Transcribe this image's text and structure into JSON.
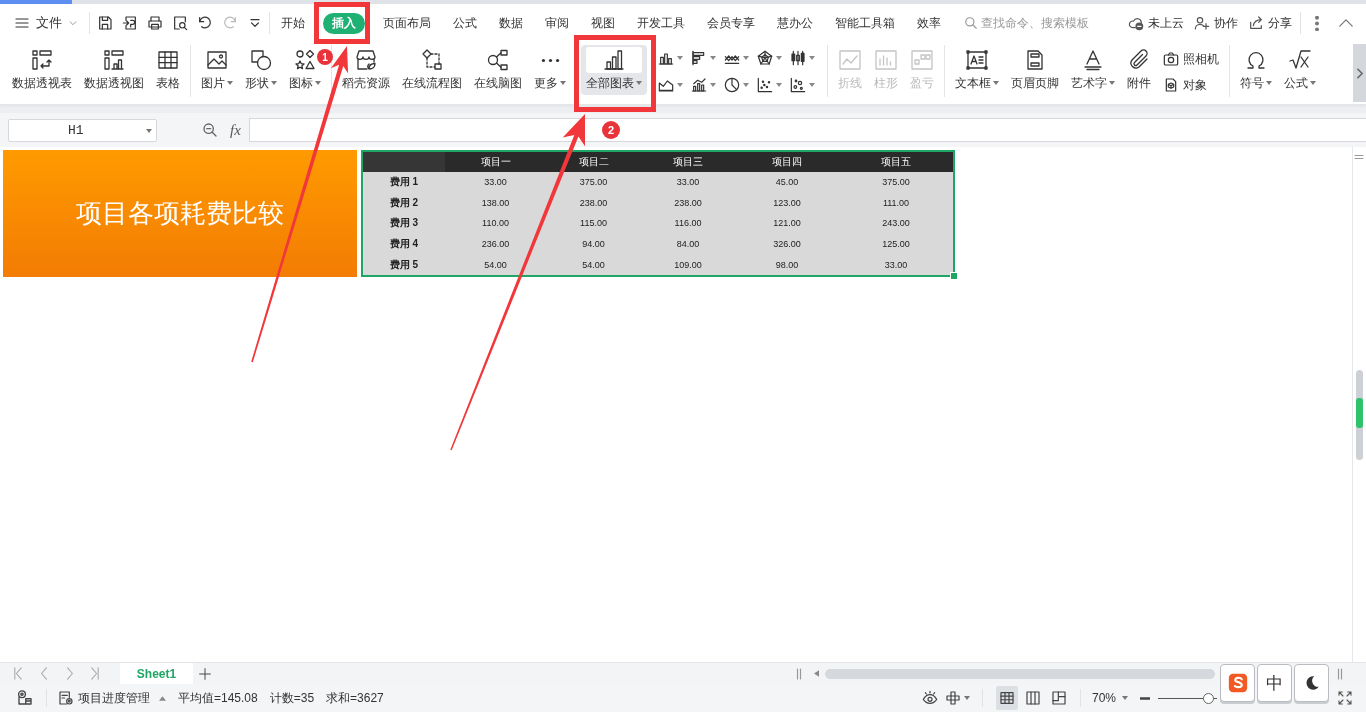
{
  "menu_bar": {
    "file_menu": {
      "label": "文件"
    },
    "quick_access": [
      {
        "kind": "save",
        "disabled": false
      },
      {
        "kind": "export",
        "disabled": false
      },
      {
        "kind": "print",
        "disabled": false
      },
      {
        "kind": "preview",
        "disabled": false
      },
      {
        "kind": "undo",
        "disabled": false
      },
      {
        "kind": "redo",
        "disabled": true
      },
      {
        "kind": "customize",
        "disabled": false
      }
    ],
    "tabs": [
      {
        "label": "开始",
        "selected": false
      },
      {
        "label": "插入",
        "selected": true
      },
      {
        "label": "页面布局",
        "selected": false
      },
      {
        "label": "公式",
        "selected": false
      },
      {
        "label": "数据",
        "selected": false
      },
      {
        "label": "审阅",
        "selected": false
      },
      {
        "label": "视图",
        "selected": false
      },
      {
        "label": "开发工具",
        "selected": false
      },
      {
        "label": "会员专享",
        "selected": false
      },
      {
        "label": "慧办公",
        "selected": false
      },
      {
        "label": "智能工具箱",
        "selected": false
      },
      {
        "label": "效率",
        "selected": false
      }
    ],
    "search": {
      "placeholder": "查找命令、搜索模板"
    },
    "actions": [
      {
        "kind": "cloud",
        "label": "未上云"
      },
      {
        "kind": "collaborate",
        "label": "协作"
      },
      {
        "kind": "share",
        "label": "分享"
      }
    ]
  },
  "ribbon": {
    "sections": [
      {
        "blocks": [
          {
            "kind": "large",
            "items": [
              {
                "kind": "pivot-table",
                "label": "数据透视表",
                "dropdown": false,
                "disabled": false,
                "highlighted": false
              },
              {
                "kind": "pivot-chart",
                "label": "数据透视图",
                "dropdown": false,
                "disabled": false,
                "highlighted": false
              },
              {
                "kind": "table",
                "label": "表格",
                "dropdown": false,
                "disabled": false,
                "highlighted": false
              }
            ]
          }
        ]
      },
      {
        "blocks": [
          {
            "kind": "large",
            "items": [
              {
                "kind": "picture",
                "label": "图片",
                "dropdown": true,
                "disabled": false,
                "highlighted": false
              },
              {
                "kind": "shape",
                "label": "形状",
                "dropdown": true,
                "disabled": false,
                "highlighted": false
              },
              {
                "kind": "icon-set",
                "label": "图标",
                "dropdown": true,
                "disabled": false,
                "highlighted": false
              }
            ]
          }
        ]
      },
      {
        "blocks": [
          {
            "kind": "large",
            "items": [
              {
                "kind": "docer",
                "label": "稻壳资源",
                "dropdown": false,
                "disabled": false,
                "highlighted": false
              },
              {
                "kind": "flowchart",
                "label": "在线流程图",
                "dropdown": false,
                "disabled": false,
                "highlighted": false
              },
              {
                "kind": "mindmap",
                "label": "在线脑图",
                "dropdown": false,
                "disabled": false,
                "highlighted": false
              },
              {
                "kind": "more",
                "label": "更多",
                "dropdown": true,
                "disabled": false,
                "highlighted": false
              }
            ]
          }
        ]
      },
      {
        "blocks": [
          {
            "kind": "large",
            "items": [
              {
                "kind": "all-charts",
                "label": "全部图表",
                "dropdown": true,
                "disabled": false,
                "highlighted": true
              }
            ]
          },
          {
            "kind": "grid",
            "items": [
              {
                "kind": "column"
              },
              {
                "kind": "bar"
              },
              {
                "kind": "line"
              },
              {
                "kind": "radar"
              },
              {
                "kind": "stock"
              },
              {
                "kind": "area"
              },
              {
                "kind": "combo"
              },
              {
                "kind": "pie"
              },
              {
                "kind": "scatter"
              },
              {
                "kind": "bubble"
              }
            ]
          }
        ]
      },
      {
        "blocks": [
          {
            "kind": "large",
            "items": [
              {
                "kind": "spark-line",
                "label": "折线",
                "dropdown": false,
                "disabled": true,
                "highlighted": false
              },
              {
                "kind": "spark-column",
                "label": "柱形",
                "dropdown": false,
                "disabled": true,
                "highlighted": false
              },
              {
                "kind": "win-loss",
                "label": "盈亏",
                "dropdown": false,
                "disabled": true,
                "highlighted": false
              }
            ]
          }
        ]
      },
      {
        "blocks": [
          {
            "kind": "large",
            "items": [
              {
                "kind": "textbox",
                "label": "文本框",
                "dropdown": true,
                "disabled": false,
                "highlighted": false
              },
              {
                "kind": "header-footer",
                "label": "页眉页脚",
                "dropdown": false,
                "disabled": false,
                "highlighted": false
              },
              {
                "kind": "wordart",
                "label": "艺术字",
                "dropdown": true,
                "disabled": false,
                "highlighted": false
              },
              {
                "kind": "attachment",
                "label": "附件",
                "dropdown": false,
                "disabled": false,
                "highlighted": false
              }
            ]
          },
          {
            "kind": "stack",
            "items": [
              {
                "kind": "camera",
                "label": "照相机"
              },
              {
                "kind": "object",
                "label": "对象"
              }
            ]
          }
        ]
      },
      {
        "blocks": [
          {
            "kind": "large",
            "items": [
              {
                "kind": "symbol",
                "label": "符号",
                "dropdown": true,
                "disabled": false,
                "highlighted": false
              },
              {
                "kind": "formula",
                "label": "公式",
                "dropdown": true,
                "disabled": false,
                "highlighted": false
              }
            ]
          }
        ]
      }
    ]
  },
  "formula_bar": {
    "name_box": "H1",
    "function_label": "fx"
  },
  "sheet": {
    "title": "项目各项耗费比较",
    "table": {
      "columns": [
        "项目一",
        "项目二",
        "项目三",
        "项目四",
        "项目五"
      ],
      "rows": [
        {
          "label": "费用 1",
          "cells": [
            "33.00",
            "375.00",
            "33.00",
            "45.00",
            "375.00"
          ]
        },
        {
          "label": "费用 2",
          "cells": [
            "138.00",
            "238.00",
            "238.00",
            "123.00",
            "111.00"
          ]
        },
        {
          "label": "费用 3",
          "cells": [
            "110.00",
            "115.00",
            "116.00",
            "121.00",
            "243.00"
          ]
        },
        {
          "label": "费用 4",
          "cells": [
            "236.00",
            "94.00",
            "84.00",
            "326.00",
            "125.00"
          ]
        },
        {
          "label": "费用 5",
          "cells": [
            "54.00",
            "54.00",
            "109.00",
            "98.00",
            "33.00"
          ]
        }
      ]
    }
  },
  "sheet_tabs": [
    {
      "label": "Sheet1",
      "selected": true
    }
  ],
  "status_bar": {
    "document": "项目进度管理",
    "stats": [
      "平均值=145.08",
      "计数=35",
      "求和=3627"
    ],
    "view_modes": [
      {
        "kind": "normal",
        "selected": true
      },
      {
        "kind": "page-break",
        "selected": false
      },
      {
        "kind": "page-layout",
        "selected": false
      }
    ],
    "zoom": {
      "reading": "70%",
      "level": 0.85
    }
  },
  "ime_toolbar": [
    {
      "kind": "logo"
    },
    {
      "kind": "text",
      "label": "中"
    },
    {
      "kind": "moon"
    }
  ],
  "annotations": [
    {
      "number": "1"
    },
    {
      "number": "2"
    }
  ]
}
